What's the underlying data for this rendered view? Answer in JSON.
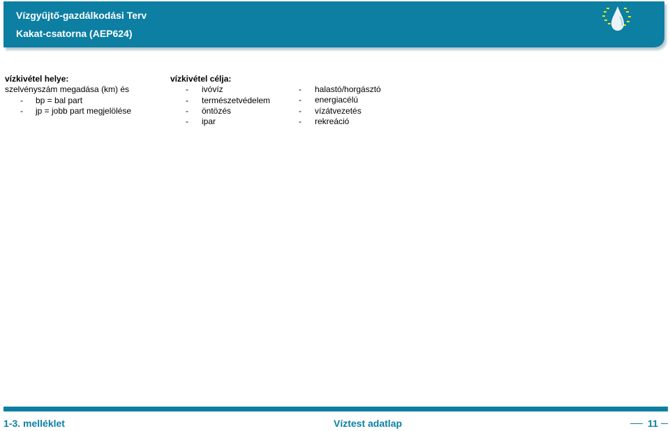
{
  "header": {
    "title": "Vízgyűjtő-gazdálkodási Terv",
    "subtitle": "Kakat-csatorna (AEP624)",
    "logo_icon": "water-drop-stars-logo"
  },
  "location": {
    "heading": "vízkivétel helye:",
    "intro": "szelvényszám megadása (km) és",
    "items": [
      {
        "dash": "-",
        "text": "bp = bal part"
      },
      {
        "dash": "-",
        "text": "jp = jobb part megjelölése"
      }
    ]
  },
  "purpose": {
    "heading": "vízkivétel célja:",
    "items_left": [
      {
        "dash": "-",
        "text": "ivóvíz"
      },
      {
        "dash": "-",
        "text": "természetvédelem"
      },
      {
        "dash": "-",
        "text": "öntözés"
      },
      {
        "dash": "-",
        "text": "ipar"
      }
    ],
    "items_right": [
      {
        "dash": "-",
        "text": "halastó/horgásztó"
      },
      {
        "dash": "-",
        "text": "energiacélú"
      },
      {
        "dash": "-",
        "text": "vízátvezetés"
      },
      {
        "dash": "-",
        "text": "rekreáció"
      }
    ]
  },
  "footer": {
    "left": "1-3. melléklet",
    "center": "Víztest adatlap",
    "page": "11"
  },
  "colors": {
    "brand": "#0c7fa3",
    "logo_star": "#f2e600"
  }
}
